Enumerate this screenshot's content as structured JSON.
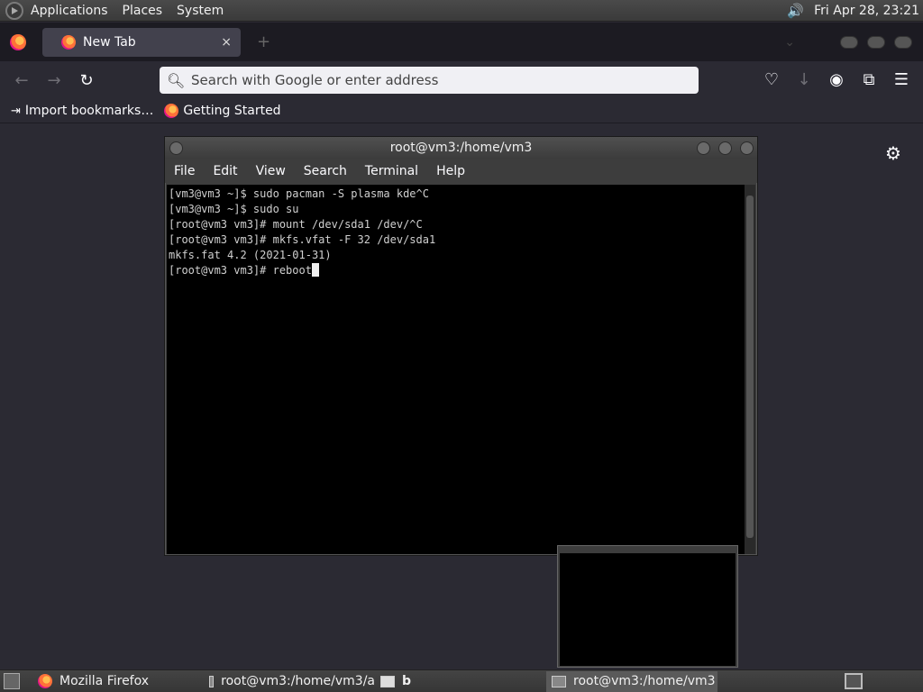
{
  "top_panel": {
    "menus": [
      "Applications",
      "Places",
      "System"
    ],
    "clock": "Fri Apr 28, 23:21"
  },
  "browser": {
    "tab_title": "New Tab",
    "tab_close": "×",
    "new_tab": "+",
    "url_placeholder": "Search with Google or enter address",
    "bookmarks": [
      {
        "label": "Import bookmarks…"
      },
      {
        "label": "Getting Started"
      }
    ]
  },
  "terminal": {
    "title": "root@vm3:/home/vm3",
    "menu": [
      "File",
      "Edit",
      "View",
      "Search",
      "Terminal",
      "Help"
    ],
    "lines": [
      "[vm3@vm3 ~]$ sudo pacman -S plasma kde^C",
      "[vm3@vm3 ~]$ sudo su",
      "[root@vm3 vm3]# mount /dev/sda1 /dev/^C",
      "[root@vm3 vm3]# mkfs.vfat -F 32 /dev/sda1",
      "mkfs.fat 4.2 (2021-01-31)",
      "[root@vm3 vm3]# reboot"
    ]
  },
  "taskbar": {
    "tasks": [
      {
        "label": "Mozilla Firefox"
      },
      {
        "label": "root@vm3:/home/vm3/a"
      },
      {
        "label": "b"
      },
      {
        "label": "root@vm3:/home/vm3"
      }
    ]
  }
}
